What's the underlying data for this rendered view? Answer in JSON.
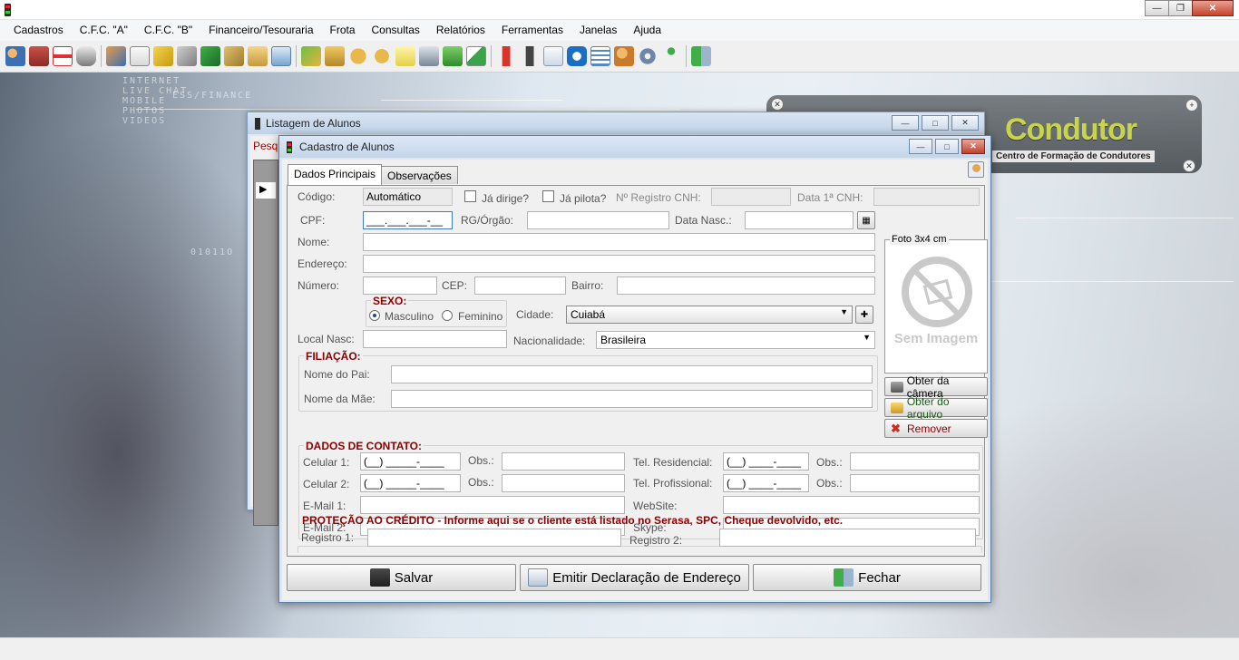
{
  "menu": [
    "Cadastros",
    "C.F.C. \"A\"",
    "C.F.C. \"B\"",
    "Financeiro/Tesouraria",
    "Frota",
    "Consultas",
    "Relatórios",
    "Ferramentas",
    "Janelas",
    "Ajuda"
  ],
  "toolbar_icons": [
    "users-icon",
    "vehicle-repair-icon",
    "first-aid-icon",
    "car-icon",
    "handshake-icon",
    "document-icon",
    "book-yellow-icon",
    "book-gray-icon",
    "book-green-icon",
    "tools-icon",
    "clipboard-icon",
    "id-card-icon",
    "money-exchange-icon",
    "package-icon",
    "money-bag-icon",
    "money-bag-add-icon",
    "notes-icon",
    "cash-register-icon",
    "banknote-icon",
    "chart-icon",
    "fire-extinguisher-icon",
    "phone-icon",
    "email-icon",
    "teamviewer-icon",
    "list-icon",
    "user-lock-icon",
    "gears-icon",
    "person-green-icon",
    "exit-icon"
  ],
  "logo": {
    "title": "Condutor",
    "subtitle": "Centro de Formação de Condutores"
  },
  "back_window": {
    "title": "Listagem de Alunos",
    "search_label": "Pesq"
  },
  "dialog": {
    "title": "Cadastro de Alunos",
    "tabs": [
      "Dados Principais",
      "Observações"
    ],
    "fields": {
      "codigo_label": "Código:",
      "codigo_value": "Automático",
      "ja_dirige": "Já dirige?",
      "ja_pilota": "Já pilota?",
      "registro_cnh": "Nº Registro CNH:",
      "data_cnh": "Data 1ª CNH:",
      "cpf_label": "CPF:",
      "cpf_value": "___.___.___-__",
      "rg_label": "RG/Órgão:",
      "data_nasc": "Data Nasc.:",
      "nome": "Nome:",
      "endereco": "Endereço:",
      "numero": "Número:",
      "cep": "CEP:",
      "bairro": "Bairro:",
      "sexo": "SEXO:",
      "masculino": "Masculino",
      "feminino": "Feminino",
      "cidade_label": "Cidade:",
      "cidade_value": "Cuiabá",
      "local_nasc": "Local Nasc:",
      "nacionalidade_label": "Nacionalidade:",
      "nacionalidade_value": "Brasileira",
      "filiacao": "FILIAÇÃO:",
      "nome_pai": "Nome do Pai:",
      "nome_mae": "Nome da Mãe:",
      "contato": "DADOS DE CONTATO:",
      "celular1": "Celular 1:",
      "celular2": "Celular 2:",
      "phone_mask": "(__) _____-____",
      "tel_mask": "(__) ____-____",
      "obs": "Obs.:",
      "tel_res": "Tel. Residencial:",
      "tel_prof": "Tel. Profissional:",
      "email1": "E-Mail 1:",
      "email2": "E-Mail 2:",
      "website": "WebSite:",
      "skype": "Skype:",
      "protecao": "PROTEÇÃO AO CRÉDITO - Informe aqui se o cliente está listado no Serasa, SPC, Cheque devolvido, etc.",
      "registro1": "Registro 1:",
      "registro2": "Registro 2:"
    },
    "photo": {
      "label": "Foto 3x4 cm",
      "placeholder": "Sem Imagem",
      "btn_camera": "Obter da câmera",
      "btn_file": "Obter do arquivo",
      "btn_remove": "Remover"
    },
    "footer": {
      "save": "Salvar",
      "declaration": "Emitir Declaração de Endereço",
      "close": "Fechar"
    }
  }
}
